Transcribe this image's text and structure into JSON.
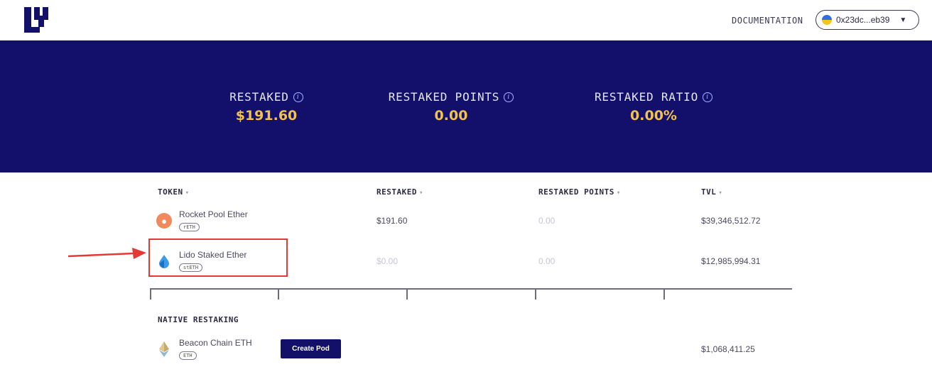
{
  "header": {
    "documentation_label": "DOCUMENTATION",
    "wallet_address": "0x23dc...eb39"
  },
  "stats": [
    {
      "label": "RESTAKED",
      "value": "$191.60"
    },
    {
      "label": "RESTAKED POINTS",
      "value": "0.00"
    },
    {
      "label": "RESTAKED RATIO",
      "value": "0.00%"
    }
  ],
  "table": {
    "columns": [
      "TOKEN",
      "RESTAKED",
      "RESTAKED POINTS",
      "TVL"
    ],
    "rows": [
      {
        "name": "Rocket Pool Ether",
        "symbol": "rETH",
        "restaked": "$191.60",
        "points": "0.00",
        "tvl": "$39,346,512.72"
      },
      {
        "name": "Lido Staked Ether",
        "symbol": "stETH",
        "restaked": "$0.00",
        "points": "0.00",
        "tvl": "$12,985,994.31"
      }
    ]
  },
  "native": {
    "section_title": "NATIVE RESTAKING",
    "name": "Beacon Chain ETH",
    "symbol": "ETH",
    "button_label": "Create Pod",
    "tvl": "$1,068,411.25"
  },
  "colors": {
    "banner_bg": "#12106b",
    "stat_value": "#f2c14e",
    "highlight": "#e53935"
  }
}
